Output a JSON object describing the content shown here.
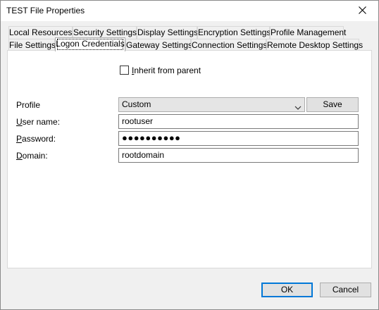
{
  "window": {
    "title": "TEST File Properties"
  },
  "tabs_row1": [
    {
      "label": "Local Resources"
    },
    {
      "label": "Security Settings"
    },
    {
      "label": "Display Settings"
    },
    {
      "label": "Encryption Settings"
    },
    {
      "label": "Profile Management"
    }
  ],
  "tabs_row2": [
    {
      "label": "File Settings"
    },
    {
      "label": "Logon Credentials",
      "active": true
    },
    {
      "label": "Gateway Settings"
    },
    {
      "label": "Connection Settings"
    },
    {
      "label": "Remote Desktop Settings"
    }
  ],
  "inherit": {
    "label_hotkey": "I",
    "label_rest": "nherit from parent",
    "checked": false
  },
  "profile": {
    "label": "Profile",
    "value": "Custom",
    "save_label": "Save"
  },
  "username": {
    "label_hotkey": "U",
    "label_rest": "ser name:",
    "value": "rootuser"
  },
  "password": {
    "label_hotkey": "P",
    "label_rest": "assword:",
    "value": "●●●●●●●●●●"
  },
  "domain": {
    "label_hotkey": "D",
    "label_rest": "omain:",
    "value": "rootdomain"
  },
  "buttons": {
    "ok": "OK",
    "cancel": "Cancel"
  },
  "icons": {
    "close": "close-icon",
    "dropdown": "chevron-down-icon"
  },
  "colors": {
    "focus_border": "#0078d7",
    "panel_bg": "#ffffff",
    "dialog_bg": "#f0f0f0"
  }
}
